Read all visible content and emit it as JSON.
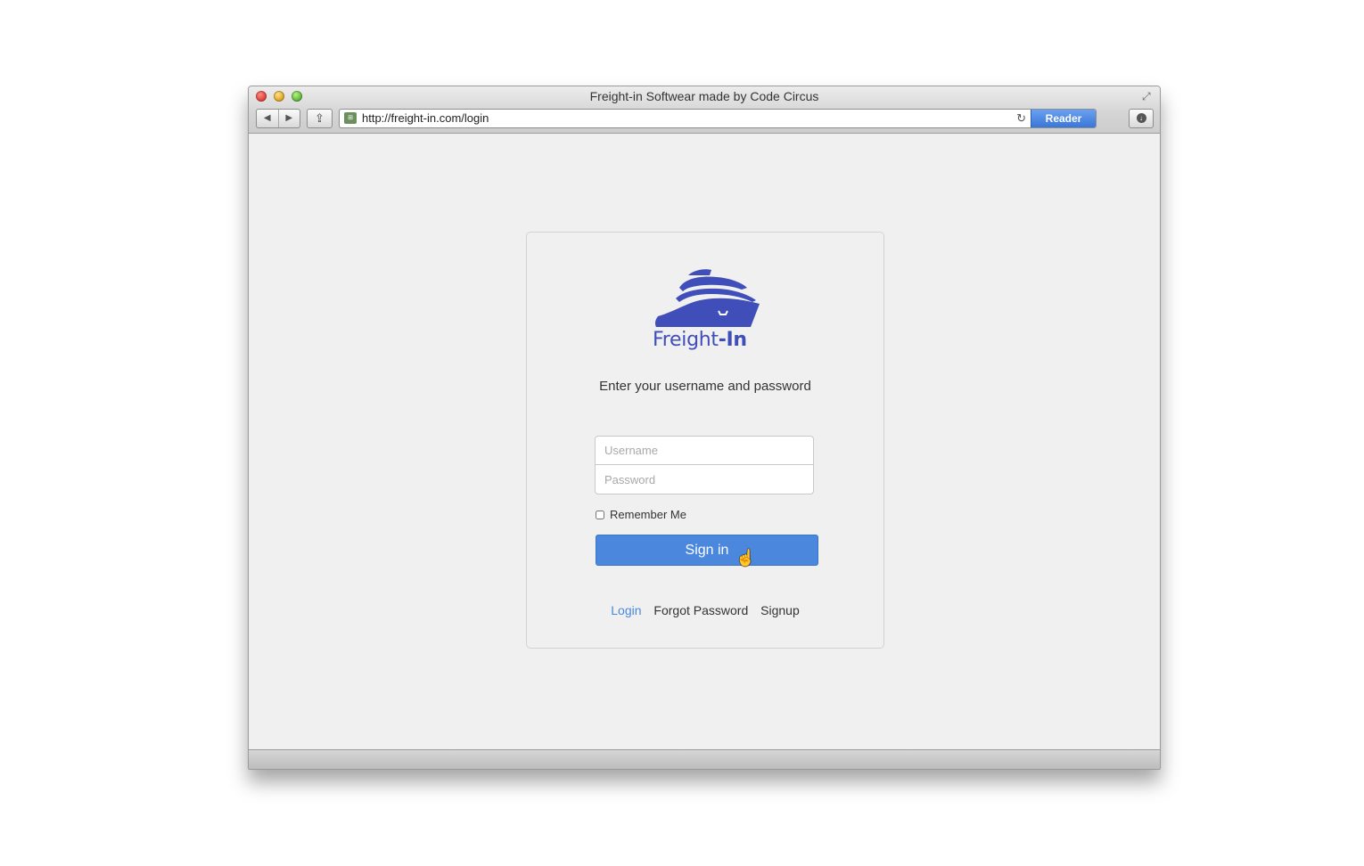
{
  "browser": {
    "title": "Freight-in Softwear made by Code Circus",
    "url": "http://freight-in.com/login",
    "reader_label": "Reader",
    "back_icon": "◀",
    "forward_icon": "▶",
    "share_icon": "⇪",
    "reload_icon": "↻",
    "site_icon": "⊞"
  },
  "logo": {
    "text_light": "Freight",
    "text_bold": "-In",
    "color": "#3f4eb8"
  },
  "login": {
    "prompt": "Enter your username and password",
    "username_placeholder": "Username",
    "password_placeholder": "Password",
    "remember_label": "Remember Me",
    "signin_label": "Sign in"
  },
  "links": {
    "login": "Login",
    "forgot": "Forgot Password",
    "signup": "Signup"
  },
  "colors": {
    "accent": "#4a87dd",
    "reader": "#3a77d8"
  }
}
